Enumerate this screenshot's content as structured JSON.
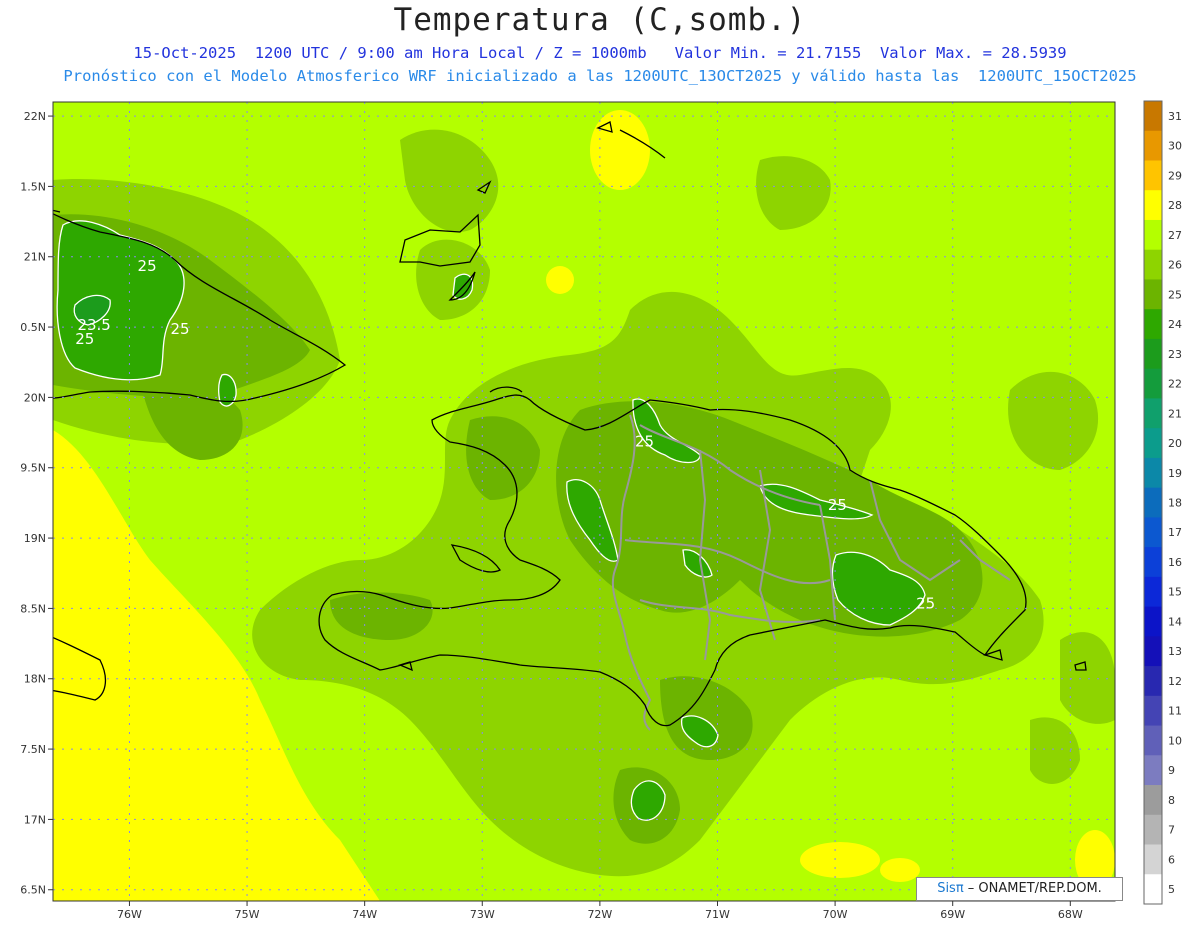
{
  "title": "Temperatura (C,somb.)",
  "subtitle_1": "15-Oct-2025  1200 UTC / 9:00 am Hora Local / Z = 1000mb   Valor Min. = 21.7155  Valor Max. = 28.5939",
  "subtitle_2": "Pronóstico con el Modelo Atmosferico WRF inicializado a las 1200UTC_13OCT2025 y válido hasta las  1200UTC_15OCT2025",
  "credit": {
    "brand": "Sisπ",
    "text": " – ONAMET/REP.DOM."
  },
  "map": {
    "lon_range": [
      -76.65,
      -67.62
    ],
    "lat_range": [
      16.42,
      22.1
    ],
    "lon_ticks": [
      "76W",
      "75W",
      "74W",
      "73W",
      "72W",
      "71W",
      "70W",
      "69W",
      "68W"
    ],
    "lat_ticks": [
      "22N",
      "1.5N",
      "21N",
      "0.5N",
      "20N",
      "9.5N",
      "19N",
      "8.5N",
      "18N",
      "7.5N",
      "17N",
      "6.5N"
    ],
    "contour_labels": [
      {
        "text": "25",
        "lon": -75.85,
        "lat": 20.9
      },
      {
        "text": "23.5",
        "lon": -76.3,
        "lat": 20.48
      },
      {
        "text": "25",
        "lon": -76.38,
        "lat": 20.38
      },
      {
        "text": "25",
        "lon": -75.57,
        "lat": 20.45
      },
      {
        "text": "25",
        "lon": -71.62,
        "lat": 19.65
      },
      {
        "text": "25",
        "lon": -69.98,
        "lat": 19.2
      },
      {
        "text": "25",
        "lon": -69.23,
        "lat": 18.5
      }
    ]
  },
  "colorbar": {
    "labels": [
      "31",
      "30",
      "29",
      "28",
      "27",
      "26",
      "25",
      "24",
      "23",
      "22",
      "21",
      "20",
      "19",
      "18",
      "17",
      "16",
      "15",
      "14",
      "13",
      "12",
      "11",
      "10",
      "9",
      "8",
      "7",
      "6",
      "5"
    ],
    "colors": [
      "#c87800",
      "#e89800",
      "#ffc400",
      "#ffff00",
      "#b4ff00",
      "#8ed400",
      "#6cb400",
      "#2ea800",
      "#1c9c1c",
      "#149c3c",
      "#10a06c",
      "#0c9c8c",
      "#0c88a8",
      "#0c6cbc",
      "#0c58d0",
      "#0c40d8",
      "#0c28d8",
      "#0c14c8",
      "#1410b8",
      "#2828b0",
      "#4444b4",
      "#6060b8",
      "#7c7cc0",
      "#9c9c9c",
      "#b4b4b4",
      "#d4d4d4",
      "#ffffff"
    ]
  }
}
